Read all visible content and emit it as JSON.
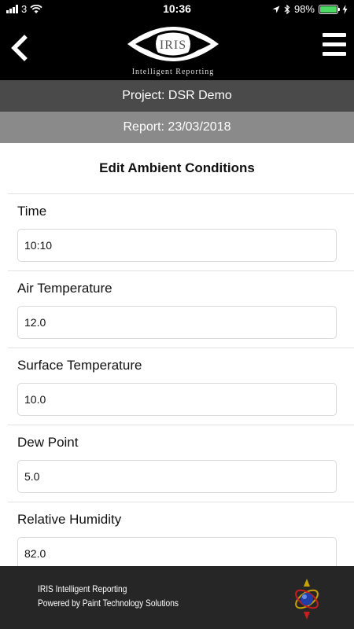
{
  "status_bar": {
    "carrier": "3",
    "time": "10:36",
    "battery_percent": "98%",
    "battery_level": 0.98,
    "icons": [
      "signal-icon",
      "wifi-icon",
      "location-icon",
      "bluetooth-icon",
      "battery-icon",
      "charging-icon"
    ]
  },
  "header": {
    "logo_word": "IRIS",
    "logo_tagline": "Intelligent Reporting",
    "back_icon": "chevron-left-icon",
    "menu_icon": "hamburger-menu-icon"
  },
  "project_bar": {
    "text": "Project: DSR Demo"
  },
  "report_bar": {
    "text": "Report: 23/03/2018"
  },
  "page_title": "Edit Ambient Conditions",
  "form": {
    "fields": [
      {
        "label": "Time",
        "value": "10:10"
      },
      {
        "label": "Air Temperature",
        "value": "12.0"
      },
      {
        "label": "Surface Temperature",
        "value": "10.0"
      },
      {
        "label": "Dew Point",
        "value": "5.0"
      },
      {
        "label": "Relative Humidity",
        "value": "82.0"
      }
    ]
  },
  "footer": {
    "line1": "IRIS Intelligent Reporting",
    "line2": "Powered by Paint Technology Solutions"
  },
  "colors": {
    "header_bg": "#000000",
    "project_bar_bg": "#4a4a4a",
    "report_bar_bg": "#8a8a8a",
    "footer_bg": "#262626",
    "battery_fill": "#4cd964"
  }
}
